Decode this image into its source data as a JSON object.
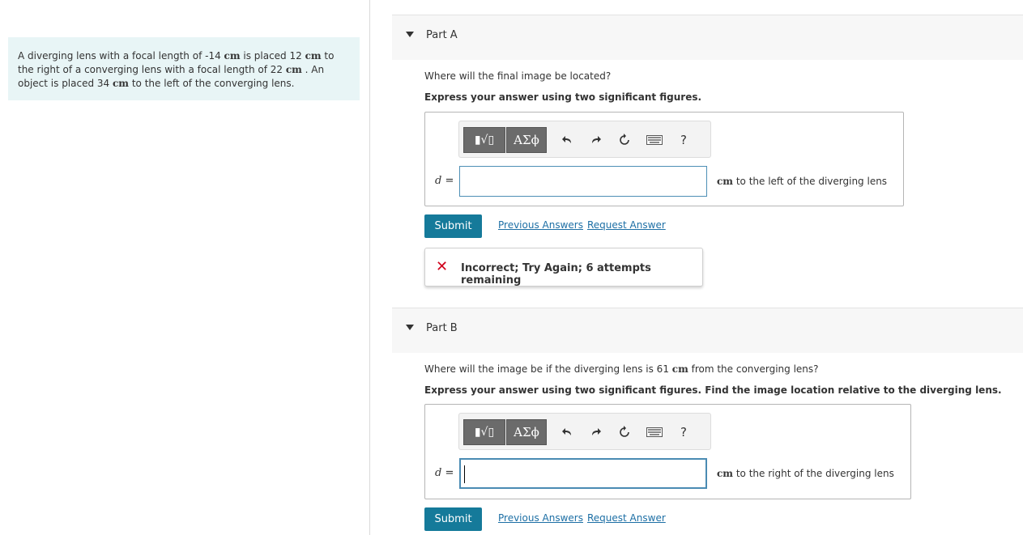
{
  "problem": {
    "parts": [
      "A diverging lens with a focal length of -14 ",
      "cm",
      " is placed 12 ",
      "cm",
      " to the right of a converging lens with a focal length of 22 ",
      "cm",
      " . An object is placed 34 ",
      "cm",
      " to the left of the converging lens."
    ]
  },
  "part_a": {
    "label": "Part A",
    "question": "Where will the final image be located?",
    "instruction": "Express your answer using two significant figures.",
    "toolbar": {
      "templates": "▮√▯",
      "symbols": "ΑΣϕ",
      "help": "?"
    },
    "var": "d",
    "eq": " =",
    "input_value": "",
    "unit": "cm",
    "unit_suffix": "  to the left of the diverging lens",
    "submit": "Submit",
    "previous_answers": "Previous Answers",
    "request_answer": "Request Answer",
    "feedback": "Incorrect; Try Again; 6 attempts remaining"
  },
  "part_b": {
    "label": "Part B",
    "question_pre": "Where will the image be if the diverging lens is 61 ",
    "question_unit": "cm",
    "question_post": " from the converging lens?",
    "instruction": "Express your answer using two significant figures. Find the image location relative to the diverging lens.",
    "toolbar": {
      "templates": "▮√▯",
      "symbols": "ΑΣϕ",
      "help": "?"
    },
    "var": "d",
    "eq": " =",
    "input_value": "",
    "unit": "cm",
    "unit_suffix": "  to the right of the diverging lens",
    "submit": "Submit",
    "previous_answers": "Previous Answers",
    "request_answer": "Request Answer"
  },
  "icons": [
    "undo-icon",
    "redo-icon",
    "reset-icon",
    "keyboard-icon"
  ],
  "colors": {
    "accent": "#157a9a",
    "link": "#1d6fa5",
    "error": "#d0021b",
    "problem_bg": "#e8f5f6"
  }
}
